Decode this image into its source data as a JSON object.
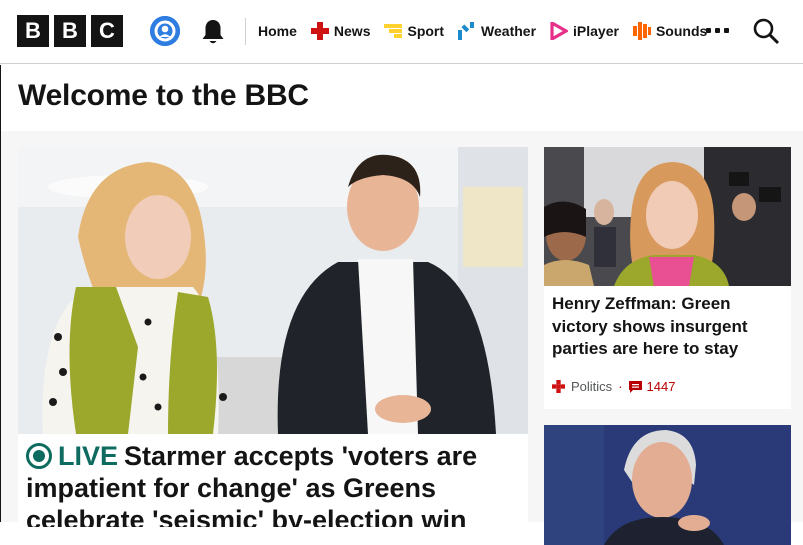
{
  "header": {
    "logo_letters": [
      "B",
      "B",
      "C"
    ],
    "nav": [
      {
        "label": "Home",
        "icon": null
      },
      {
        "label": "News",
        "icon": "news-icon",
        "color": "#ce1212"
      },
      {
        "label": "Sport",
        "icon": "sport-icon",
        "color": "#ffd230"
      },
      {
        "label": "Weather",
        "icon": "weather-icon",
        "color": "#1b8bcb"
      },
      {
        "label": "iPlayer",
        "icon": "iplayer-icon",
        "color": "#e6308a"
      },
      {
        "label": "Sounds",
        "icon": "sounds-icon",
        "color": "#ff6600"
      }
    ]
  },
  "page": {
    "title": "Welcome to the BBC"
  },
  "main_story": {
    "live_label": "LIVE",
    "headline": "Starmer accepts 'voters are impatient for change' as Greens celebrate 'seismic' by-election win",
    "accent": "#0e6b5f"
  },
  "side_story": {
    "headline": "Henry Zeffman: Green victory shows insurgent parties are here to stay",
    "topic": "Politics",
    "comments": "1447"
  },
  "colors": {
    "brand_red": "#b80000",
    "account_blue": "#2e7de0"
  }
}
